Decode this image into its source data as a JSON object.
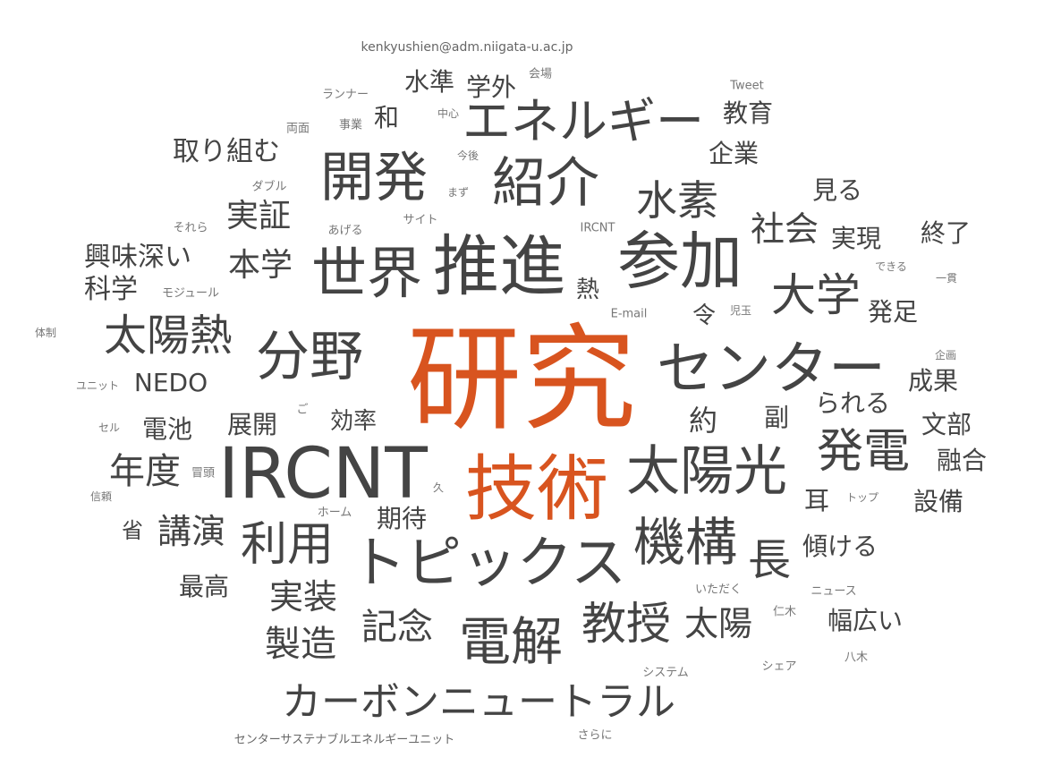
{
  "words": {
    "kenkyu": "研究",
    "gijutsu": "技術",
    "ircnt": "IRCNT",
    "suishin": "推進",
    "sanka": "参加",
    "center": "センター",
    "topics": "トピックス",
    "sekai": "世界",
    "kaihatsu": "開発",
    "shokai": "紹介",
    "energy": "エネルギー",
    "bunya": "分野",
    "taiyoko": "太陽光",
    "kikou": "機構",
    "denkai": "電解",
    "carbon": "カーボンニュートラル",
    "suiso": "水素",
    "hatsuden": "発電",
    "taiyonetsu": "太陽熱",
    "daigaku": "大学",
    "riyou": "利用",
    "kyoju": "教授",
    "cho": "長",
    "taiyo": "太陽",
    "nendo": "年度",
    "kinen": "記念",
    "seizo": "製造",
    "jisso": "実装",
    "kouen": "講演",
    "shakai": "社会",
    "jissho": "実証",
    "honkaku": "本学",
    "torikumu": "取り組む",
    "kyomibukai": "興味深い",
    "kagaku": "科学",
    "nedo": "NEDO",
    "suijun": "水準",
    "gakugai": "学外",
    "kyoiku": "教育",
    "kigyo": "企業",
    "miru": "見る",
    "jitsugen": "実現",
    "shuryo": "終了",
    "hossoku": "発足",
    "seika": "成果",
    "rareru": "られる",
    "monbu": "文部",
    "yugo": "融合",
    "setsubi": "設備",
    "katamukeru": "傾ける",
    "habahiroi": "幅広い",
    "saikou": "最高",
    "kitai": "期待",
    "tenkai": "展開",
    "denchi": "電池",
    "kouritsu": "効率",
    "yaku": "約",
    "fuku": "副",
    "mimi": "耳",
    "rei": "令",
    "netsu": "熱",
    "wa": "和",
    "sho": "省",
    "email_addr": "kenkyushien@adm.niigata-u.ac.jp",
    "runner": "ランナー",
    "kaijo": "会場",
    "tweet": "Tweet",
    "ryomen": "両面",
    "jigyo": "事業",
    "chushin": "中心",
    "konogo": "今後",
    "double": "ダブル",
    "mazu": "まず",
    "sorera": "それら",
    "ageru": "あげる",
    "site": "サイト",
    "ircnt_small": "IRCNT",
    "dekiru": "できる",
    "ikkan": "一貫",
    "module": "モジュール",
    "email": "E-mail",
    "kodama": "児玉",
    "taisei": "体制",
    "kikaku": "企画",
    "unit": "ユニット",
    "go": "ご",
    "cell": "セル",
    "boutou": "冒頭",
    "hisashi": "久",
    "shinrai": "信頼",
    "home": "ホーム",
    "top": "トップ",
    "itadaku": "いただく",
    "news": "ニュース",
    "niki": "仁木",
    "share": "シェア",
    "yagi": "八木",
    "system": "システム",
    "center_unit": "センターサステナブルエネルギーユニット",
    "sarani": "さらに"
  },
  "colors": {
    "primary": "#D8541F",
    "text": "#444444"
  }
}
